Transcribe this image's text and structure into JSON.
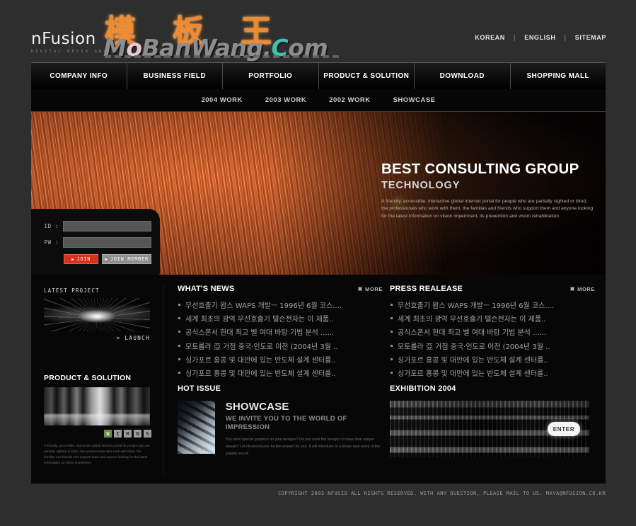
{
  "header": {
    "logo": {
      "word": "nFusion",
      "sub": "DIGITAL MEDIA GROUP"
    },
    "watermark": {
      "cjk": "模板王",
      "latin_1": "M",
      "latin_o": "o",
      "latin_2": "BanWang.",
      "latin_teal": "C",
      "latin_3": "om"
    },
    "toplinks": [
      {
        "label": "KOREAN"
      },
      {
        "label": "ENGLISH"
      },
      {
        "label": "SITEMAP"
      }
    ],
    "sep": "|"
  },
  "nav": {
    "items": [
      {
        "label": "COMPANY INFO"
      },
      {
        "label": "BUSINESS FIELD"
      },
      {
        "label": "PORTFOLIO"
      },
      {
        "label": "PRODUCT & SOLUTION"
      },
      {
        "label": "DOWNLOAD"
      },
      {
        "label": "SHOPPING MALL"
      }
    ]
  },
  "subnav": {
    "items": [
      {
        "label": "2004 WORK"
      },
      {
        "label": "2003 WORK"
      },
      {
        "label": "2002 WORK"
      },
      {
        "label": "SHOWCASE"
      }
    ]
  },
  "hero": {
    "title": "BEST CONSULTING GROUP",
    "subtitle": "TECHNOLOGY",
    "paragraph": "A friendly, accessible, interactive global internet portal for people who are partially sighted or blind, the professionals who work with them, the familias and friends who support them and anyone looking for the latest information on vision impeirment, its prevention and vision rehabilitation"
  },
  "login": {
    "id_label": "ID :",
    "pw_label": "PW :",
    "id_value": "",
    "pw_value": "",
    "id_placeholder": "",
    "pw_placeholder": "",
    "join_button": "JOIN",
    "join_member_button": "JOIN MEMBER",
    "arrow": "▶"
  },
  "sidebar": {
    "latest_project": {
      "title": "LATEST PROJECT",
      "launch": "> LAUNCH"
    },
    "product_solution": {
      "title": "PRODUCT & SOLUTION",
      "badges": [
        {
          "label": "W",
          "active": true
        },
        {
          "label": "I",
          "active": false
        },
        {
          "label": "M",
          "active": false
        },
        {
          "label": "N",
          "active": false
        },
        {
          "label": "S",
          "active": false
        }
      ],
      "paragraph": "A friendly, accessible, interactive global internet portal for people who are partially sighted or blind, the professionals who work with them, the familias and friends who support them and anyone looking for the latest information on vision impeirment"
    }
  },
  "whats_news": {
    "title": "WHAT'S NEWS",
    "more": "MORE",
    "items": [
      "무선호출기 왑스 WAPS 개발ㅡ 1996년 6월 코스....",
      "세계 최초의 광역 무선호출기 텔슨전자는 이 제품..",
      "공식스폰서 현대 최고 벨 여대 바탕 기법 분석 ......",
      "모토롤라 亞 거점 중국·인도로 이전 (2004년 3월 ..",
      "싱가포르 홍콩 및 대만에 있는 반도체 설계 센터를..",
      "싱가포르 홍콩 및 대만에 있는 반도체 설계 센터를.."
    ]
  },
  "press_release": {
    "title": "PRESS REALEASE",
    "more": "MORE",
    "items": [
      "무선호출기 왑스 WAPS 개발ㅡ 1996년 6월 코스....",
      "세계 최초의 광역 무선호출기 텔슨전자는 이 제품..",
      "공식스폰서 현대 최고 벨 여대 바탕 기법 분석 ......",
      "모토롤라 亞 거점 중국·인도로 이전 (2004년 3월 ..",
      "싱가포르 홍콩 및 대만에 있는 반도체 설계 센터를..",
      "싱가포르 홍콩 및 대만에 있는 반도체 설계 센터를.."
    ]
  },
  "hot_issue": {
    "title": "HOT ISSUE",
    "showcase_title": "SHOWCASE",
    "showcase_subtitle": "WE INVITE YOU TO THE WORLD OF IMPRESSION",
    "showcase_paragraph": "You want special graphics on your designs? Do you want the designs to have their unique visuals? Let nfusionsource be the answer for you. It will introduce to a whole new world of the graphic excell"
  },
  "exhibition": {
    "title": "EXHIBITION 2004",
    "enter_button": "ENTER"
  },
  "footer": {
    "copyright": "COPYRIGHT  2003 NFUSIO  ALL RIGHTS RESERVED.  WITH ANY QUESTION, PLEASE MAIL TO US.  MAYA@NFUSION.CO.KR"
  },
  "colors": {
    "accent_orange": "#f08a30",
    "join_red": "#d8301a",
    "teal": "#3fbfae",
    "page_bg": "#2e2e2e",
    "content_bg": "#070707"
  }
}
